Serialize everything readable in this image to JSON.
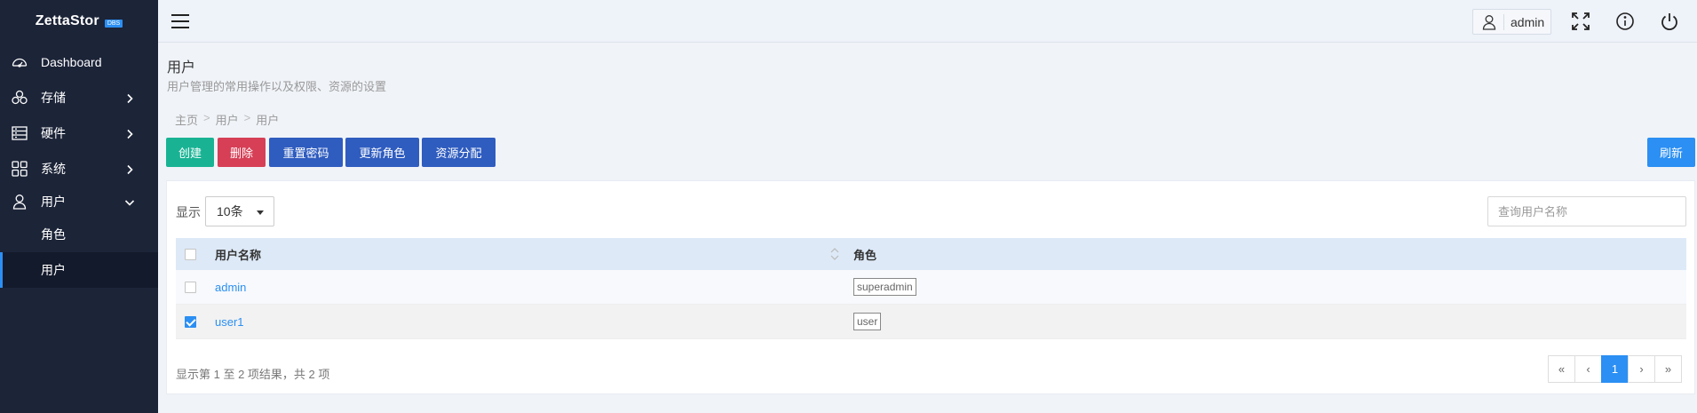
{
  "brand": {
    "name": "ZettaStor",
    "badge": "DBS",
    "accent": "#2b8ff3"
  },
  "sidebar": {
    "items": [
      {
        "label": "Dashboard",
        "icon": "speedometer-icon"
      },
      {
        "label": "存储",
        "icon": "cubes-icon"
      },
      {
        "label": "硬件",
        "icon": "server-icon"
      },
      {
        "label": "系统",
        "icon": "grid-icon"
      },
      {
        "label": "用户",
        "icon": "user-icon"
      }
    ],
    "sub_items": [
      {
        "label": "角色"
      },
      {
        "label": "用户"
      }
    ]
  },
  "topbar": {
    "username": "admin"
  },
  "page": {
    "title": "用户",
    "subtitle": "用户管理的常用操作以及权限、资源的设置"
  },
  "breadcrumb": [
    "主页",
    "用户",
    "用户"
  ],
  "breadcrumb_sep": ">",
  "toolbar": {
    "create": "创建",
    "delete": "删除",
    "reset_password": "重置密码",
    "update_role": "更新角色",
    "assign_resources": "资源分配",
    "refresh": "刷新"
  },
  "table_controls": {
    "show_label": "显示",
    "page_size": "10条",
    "search_placeholder": "查询用户名称"
  },
  "table": {
    "columns": [
      "用户名称",
      "角色"
    ],
    "rows": [
      {
        "name": "admin",
        "role": "superadmin",
        "checked": false
      },
      {
        "name": "user1",
        "role": "user",
        "checked": true
      }
    ]
  },
  "summary": "显示第 1 至 2 项结果，共 2 项",
  "pagination": {
    "first": "«",
    "prev": "‹",
    "current": "1",
    "next": "›",
    "last": "»"
  }
}
